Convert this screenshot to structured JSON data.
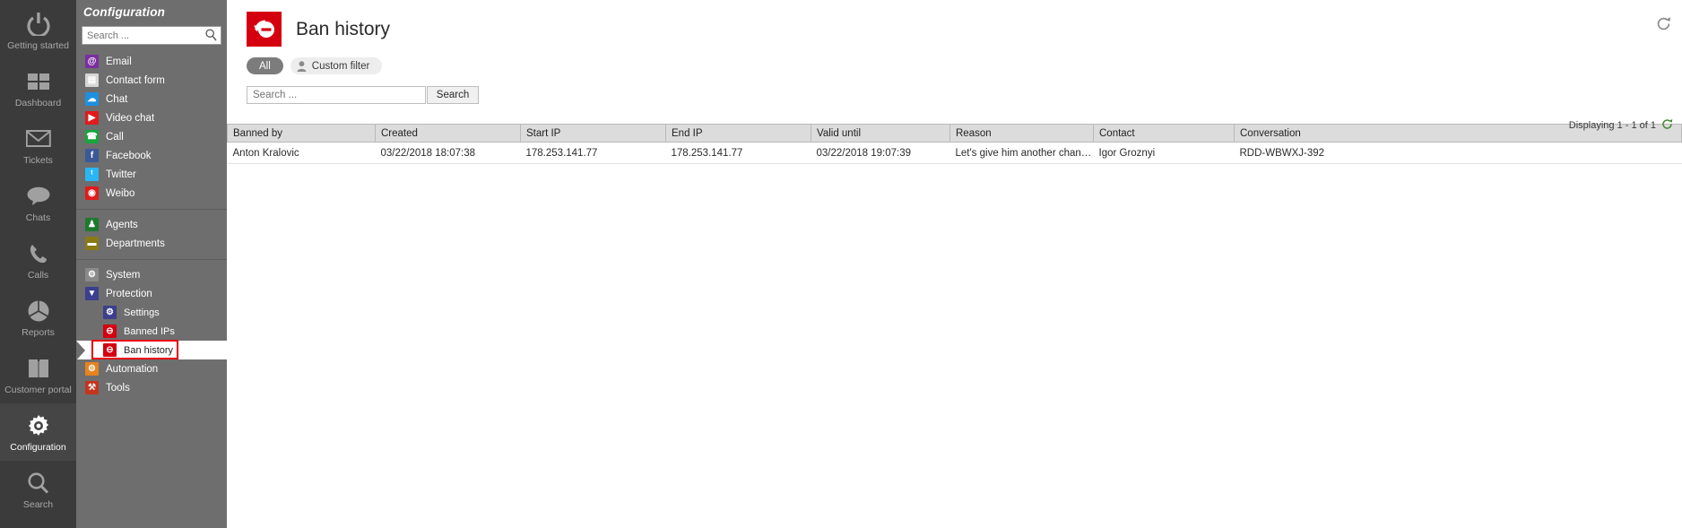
{
  "rail": {
    "items": [
      {
        "label": "Getting started",
        "icon": "power-icon",
        "active": false
      },
      {
        "label": "Dashboard",
        "icon": "grid-icon",
        "active": false
      },
      {
        "label": "Tickets",
        "icon": "envelope-icon",
        "active": false
      },
      {
        "label": "Chats",
        "icon": "speech-bubble-icon",
        "active": false
      },
      {
        "label": "Calls",
        "icon": "phone-icon",
        "active": false
      },
      {
        "label": "Reports",
        "icon": "pie-chart-icon",
        "active": false
      },
      {
        "label": "Customer portal",
        "icon": "book-icon",
        "active": false
      },
      {
        "label": "Configuration",
        "icon": "gear-icon",
        "active": true
      },
      {
        "label": "Search",
        "icon": "magnifier-icon",
        "active": false
      }
    ]
  },
  "config": {
    "title": "Configuration",
    "search_placeholder": "Search ...",
    "search_value": "",
    "groups": [
      {
        "items": [
          {
            "label": "Email",
            "icon": "at-sign-icon",
            "color": "#7a2fa0",
            "glyph": "@",
            "level": 0
          },
          {
            "label": "Contact form",
            "icon": "contact-form-icon",
            "color": "#d6d6d6",
            "glyph": "▤",
            "level": 0
          },
          {
            "label": "Chat",
            "icon": "chat-icon",
            "color": "#1e90e0",
            "glyph": "☁",
            "level": 0
          },
          {
            "label": "Video chat",
            "icon": "video-camera-icon",
            "color": "#e01b1b",
            "glyph": "▶",
            "level": 0
          },
          {
            "label": "Call",
            "icon": "telephone-icon",
            "color": "#18a53c",
            "glyph": "☎",
            "level": 0
          },
          {
            "label": "Facebook",
            "icon": "facebook-icon",
            "color": "#3b5998",
            "glyph": "f",
            "level": 0
          },
          {
            "label": "Twitter",
            "icon": "twitter-icon",
            "color": "#29b6f6",
            "glyph": "ᵗ",
            "level": 0
          },
          {
            "label": "Weibo",
            "icon": "weibo-icon",
            "color": "#e01b1b",
            "glyph": "◉",
            "level": 0
          }
        ]
      },
      {
        "items": [
          {
            "label": "Agents",
            "icon": "agents-icon",
            "color": "#1d7a2e",
            "glyph": "♟",
            "level": 0
          },
          {
            "label": "Departments",
            "icon": "folder-icon",
            "color": "#8a7a15",
            "glyph": "▬",
            "level": 0
          }
        ]
      },
      {
        "items": [
          {
            "label": "System",
            "icon": "system-gear-icon",
            "color": "#8a8a8a",
            "glyph": "⚙",
            "level": 0
          },
          {
            "label": "Protection",
            "icon": "shield-icon",
            "color": "#3b3f8c",
            "glyph": "▼",
            "level": 0
          },
          {
            "label": "Settings",
            "icon": "settings-gear-icon",
            "color": "#3b3f8c",
            "glyph": "⚙",
            "level": 1
          },
          {
            "label": "Banned IPs",
            "icon": "ban-icon",
            "color": "#d4000f",
            "glyph": "⊖",
            "level": 1
          },
          {
            "label": "Ban history",
            "icon": "ban-history-icon",
            "color": "#d4000f",
            "glyph": "⊖",
            "level": 1,
            "selected": true
          },
          {
            "label": "Automation",
            "icon": "automation-icon",
            "color": "#e8821e",
            "glyph": "⚙",
            "level": 0
          },
          {
            "label": "Tools",
            "icon": "tools-icon",
            "color": "#c4341e",
            "glyph": "⚒",
            "level": 0
          }
        ]
      }
    ]
  },
  "page": {
    "title": "Ban history",
    "icon": "ban-history-icon",
    "refresh_icon": "refresh-icon",
    "accent_color": "#d4000f"
  },
  "filters": {
    "tabs": [
      {
        "label": "All",
        "active": true,
        "icon": null
      },
      {
        "label": "Custom filter",
        "active": false,
        "icon": "person-icon"
      }
    ]
  },
  "search": {
    "placeholder": "Search ...",
    "value": "",
    "button_label": "Search"
  },
  "results": {
    "displaying_text": "Displaying 1 - 1 of 1",
    "refresh_icon": "refresh-icon"
  },
  "table": {
    "columns": [
      "Banned by",
      "Created",
      "Start IP",
      "End IP",
      "Valid until",
      "Reason",
      "Contact",
      "Conversation"
    ],
    "rows": [
      {
        "banned_by": "Anton Kralovic",
        "created": "03/22/2018 18:07:38",
        "start_ip": "178.253.141.77",
        "end_ip": "178.253.141.77",
        "valid_until": "03/22/2018 19:07:39",
        "reason": "Let's give him another chance later ...",
        "contact": "Igor Groznyi",
        "conversation": "RDD-WBWXJ-392"
      }
    ]
  }
}
